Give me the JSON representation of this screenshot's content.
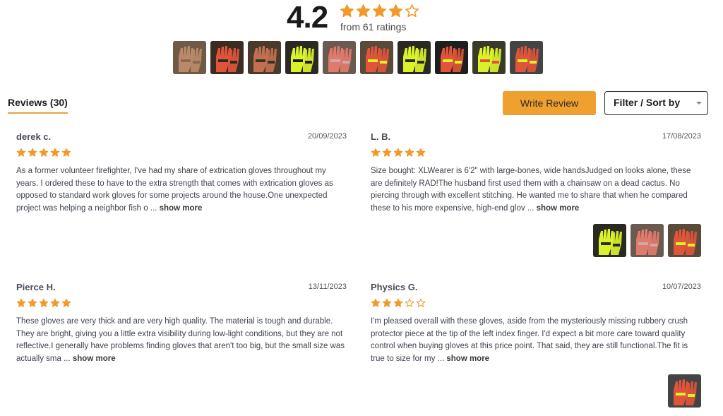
{
  "summary": {
    "score": "4.2",
    "stars": [
      1,
      1,
      1,
      1,
      0
    ],
    "from_ratings": "from 61 ratings",
    "photos": [
      "glove-photo-1",
      "glove-photo-2",
      "glove-photo-3",
      "glove-photo-4",
      "glove-photo-5",
      "glove-photo-6",
      "glove-photo-7",
      "glove-photo-8",
      "glove-photo-9",
      "glove-photo-10"
    ]
  },
  "tabs": {
    "reviews_label": "Reviews (30)",
    "write_review": "Write Review",
    "filter_sort": "Filter / Sort by"
  },
  "colors": {
    "accent": "#f0a02e",
    "star": "#f2992a",
    "glove_yellow": "#d9f22a",
    "glove_red": "#e0553a"
  },
  "reviews": [
    {
      "author": "derek c.",
      "date": "20/09/2023",
      "rating": 5,
      "body": "As a former volunteer firefighter, I've had my share of extrication gloves throughout my years.  I ordered these to have to the extra strength that comes with extrication gloves as opposed to standard work gloves for some projects around the house.One unexpected project was helping a neighbor fish o ... ",
      "show_more": "show more",
      "photos": []
    },
    {
      "author": "L. B.",
      "date": "17/08/2023",
      "rating": 5,
      "body": "Size bought: XLWearer is 6'2\" with large-bones, wide handsJudged on looks alone, these are definitely RAD!The husband first used them with a chainsaw on a dead cactus. No piercing through with excellent stitching. He wanted me to share that when he compared these to his more expensive, high-end glov ... ",
      "show_more": "show more",
      "photos": [
        "review-photo-1",
        "review-photo-2",
        "review-photo-3"
      ]
    },
    {
      "author": "Pierce H.",
      "date": "13/11/2023",
      "rating": 5,
      "body": "These gloves are very thick and are very high quality.  The material is tough and durable.  They are bright, giving you a little extra visibility during low-light conditions, but they are not reflective.I generally have problems finding gloves that aren't too big, but the small size was actually sma ... ",
      "show_more": "show more",
      "photos": []
    },
    {
      "author": "Physics G.",
      "date": "10/07/2023",
      "rating": 3,
      "body": "I'm pleased overall with these gloves, aside from the mysteriously missing rubbery crush protector piece at the tip of the left index finger. I'd expect a bit more care toward quality control when buying gloves at this price point. That said, they are still functional.The fit is true to size for my  ... ",
      "show_more": "show more",
      "photos": [
        "review-photo-4"
      ]
    }
  ]
}
